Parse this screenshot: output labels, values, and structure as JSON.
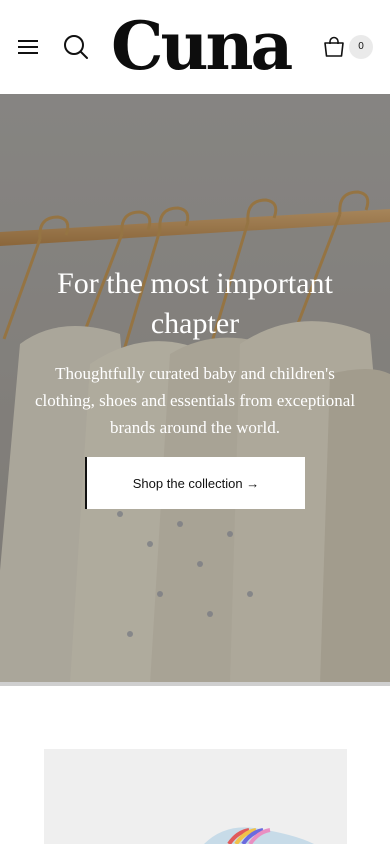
{
  "header": {
    "logo_text": "Cuna",
    "menu_icon": "hamburger-menu-icon",
    "search_icon": "search-icon",
    "cart_icon": "shopping-bag-icon",
    "cart_count": "0"
  },
  "hero": {
    "title": "For the most important chapter",
    "subtitle": "Thoughtfully curated baby and children's clothing, shoes and essentials from exceptional brands around the world.",
    "cta_label": "Shop the collection →",
    "image": "clothing-rail-photo"
  },
  "featured": {
    "image": "product-photo"
  },
  "colors": {
    "background": "#ffffff",
    "text": "#111111",
    "hero_text": "#ffffff",
    "cart_badge": "#eaeaea"
  }
}
